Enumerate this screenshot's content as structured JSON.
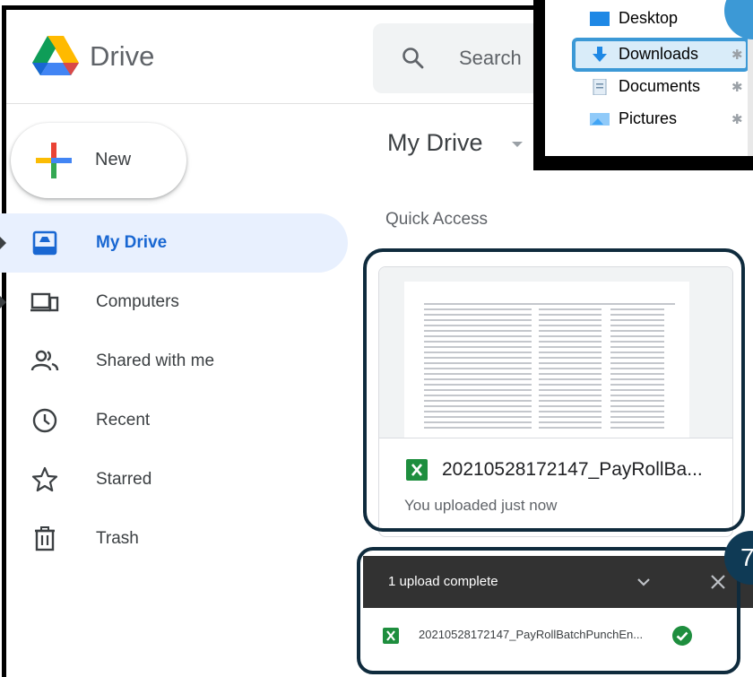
{
  "brand": {
    "name": "Drive"
  },
  "search": {
    "placeholder": "Search"
  },
  "new_button": {
    "label": "New"
  },
  "sidebar": {
    "items": [
      {
        "label": "My Drive",
        "active": true,
        "icon": "my-drive-icon"
      },
      {
        "label": "Computers",
        "active": false,
        "icon": "computers-icon"
      },
      {
        "label": "Shared with me",
        "active": false,
        "icon": "shared-icon"
      },
      {
        "label": "Recent",
        "active": false,
        "icon": "clock-icon"
      },
      {
        "label": "Starred",
        "active": false,
        "icon": "star-icon"
      },
      {
        "label": "Trash",
        "active": false,
        "icon": "trash-icon"
      }
    ]
  },
  "main": {
    "title": "My Drive",
    "quick_access": "Quick Access",
    "file": {
      "name": "20210528172147_PayRollBa...",
      "subtitle": "You uploaded just now"
    }
  },
  "upload_panel": {
    "title": "1 upload complete",
    "file_name": "20210528172147_PayRollBatchPunchEn..."
  },
  "step_badge": "7",
  "explorer": {
    "items": [
      {
        "label": "Desktop",
        "icon": "desktop-folder-icon"
      },
      {
        "label": "Downloads",
        "icon": "downloads-folder-icon",
        "selected": true
      },
      {
        "label": "Documents",
        "icon": "documents-folder-icon"
      },
      {
        "label": "Pictures",
        "icon": "pictures-folder-icon"
      }
    ]
  },
  "colors": {
    "accent": "#1967d2",
    "active_bg": "#e8f0fe",
    "highlight_border": "#0f2b3d",
    "explorer_select": "#3c99d6",
    "excel_green": "#1e8e3e"
  }
}
